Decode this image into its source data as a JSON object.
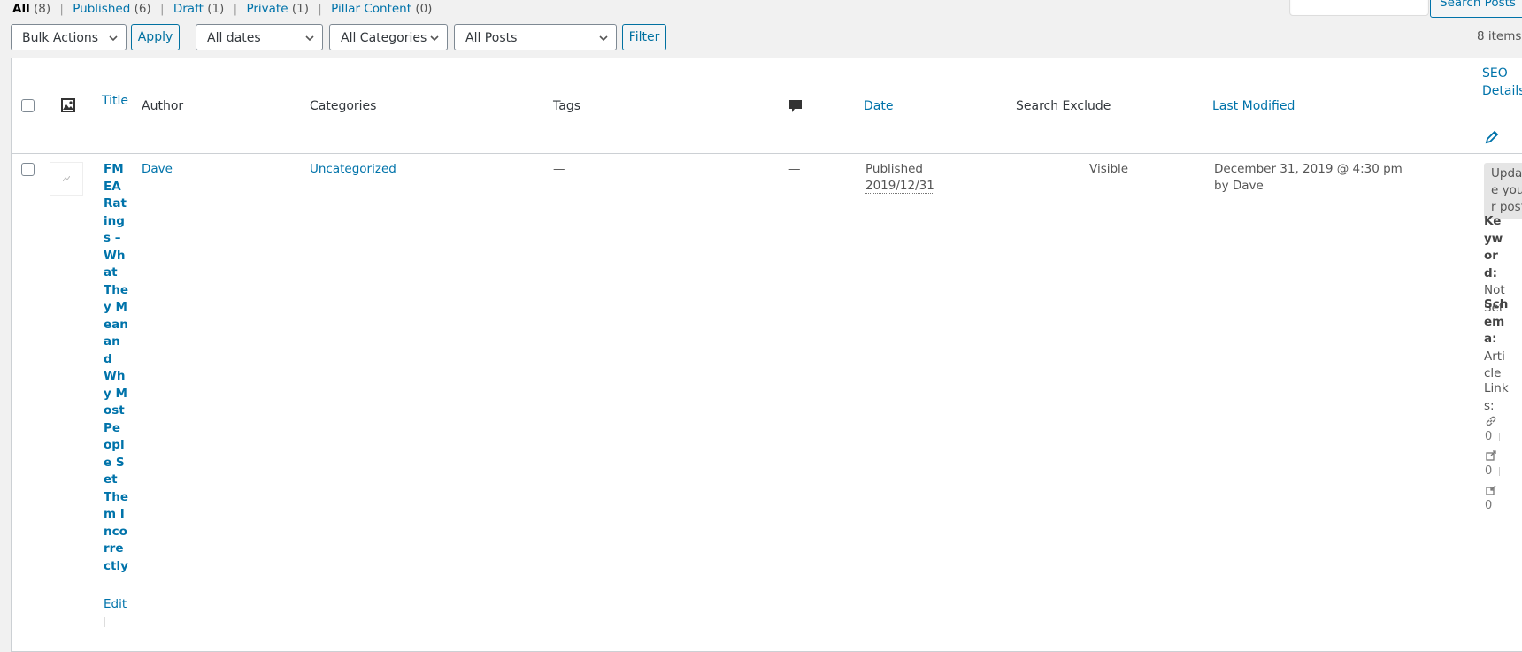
{
  "views": {
    "all_label": "All",
    "all_count": "(8)",
    "published_label": "Published",
    "published_count": "(6)",
    "draft_label": "Draft",
    "draft_count": "(1)",
    "private_label": "Private",
    "private_count": "(1)",
    "pillar_label": "Pillar Content",
    "pillar_count": "(0)",
    "separator": "|"
  },
  "search": {
    "value": "",
    "button_label": "Search Posts"
  },
  "tablenav": {
    "bulk_actions": "Bulk Actions",
    "apply_label": "Apply",
    "dates": "All dates",
    "categories": "All Categories",
    "posts": "All Posts",
    "filter_label": "Filter",
    "items_count": "8 items"
  },
  "columns": {
    "title": "Title",
    "author": "Author",
    "categories": "Categories",
    "tags": "Tags",
    "date": "Date",
    "search_exclude": "Search Exclude",
    "last_modified": "Last Modified",
    "seo_details": "SEO Details"
  },
  "row": {
    "title": "FMEA Ratings – What They Mean and Why Most People Set Them Incorrectly",
    "edit_label": "Edit",
    "author": "Dave",
    "category": "Uncategorized",
    "tags": "—",
    "comments": "—",
    "date_status": "Published",
    "date_value": "2019/12/31",
    "search_exclude": "Visible",
    "last_modified": "December 31, 2019 @ 4:30 pm",
    "modified_by_prefix": "by",
    "modified_by": "Dave",
    "seo": {
      "update_label": "Update your post",
      "keyword_label": "Keyword:",
      "keyword_value": "Not Set",
      "schema_label": "Schema:",
      "schema_value": "Article",
      "links_label": "Links:",
      "internal_count": "0",
      "external_count": "0",
      "incoming_count": "0"
    }
  },
  "icons": {
    "thumbnail_header": "image-icon",
    "comments_header": "comment-bubble-icon",
    "seo_edit": "pencil-icon",
    "internal_link": "link-icon",
    "external_link": "external-link-icon",
    "incoming_link": "incoming-link-icon"
  },
  "colors": {
    "link": "#0073aa",
    "background": "#f1f1f1",
    "table_border": "#ccd0d4"
  }
}
